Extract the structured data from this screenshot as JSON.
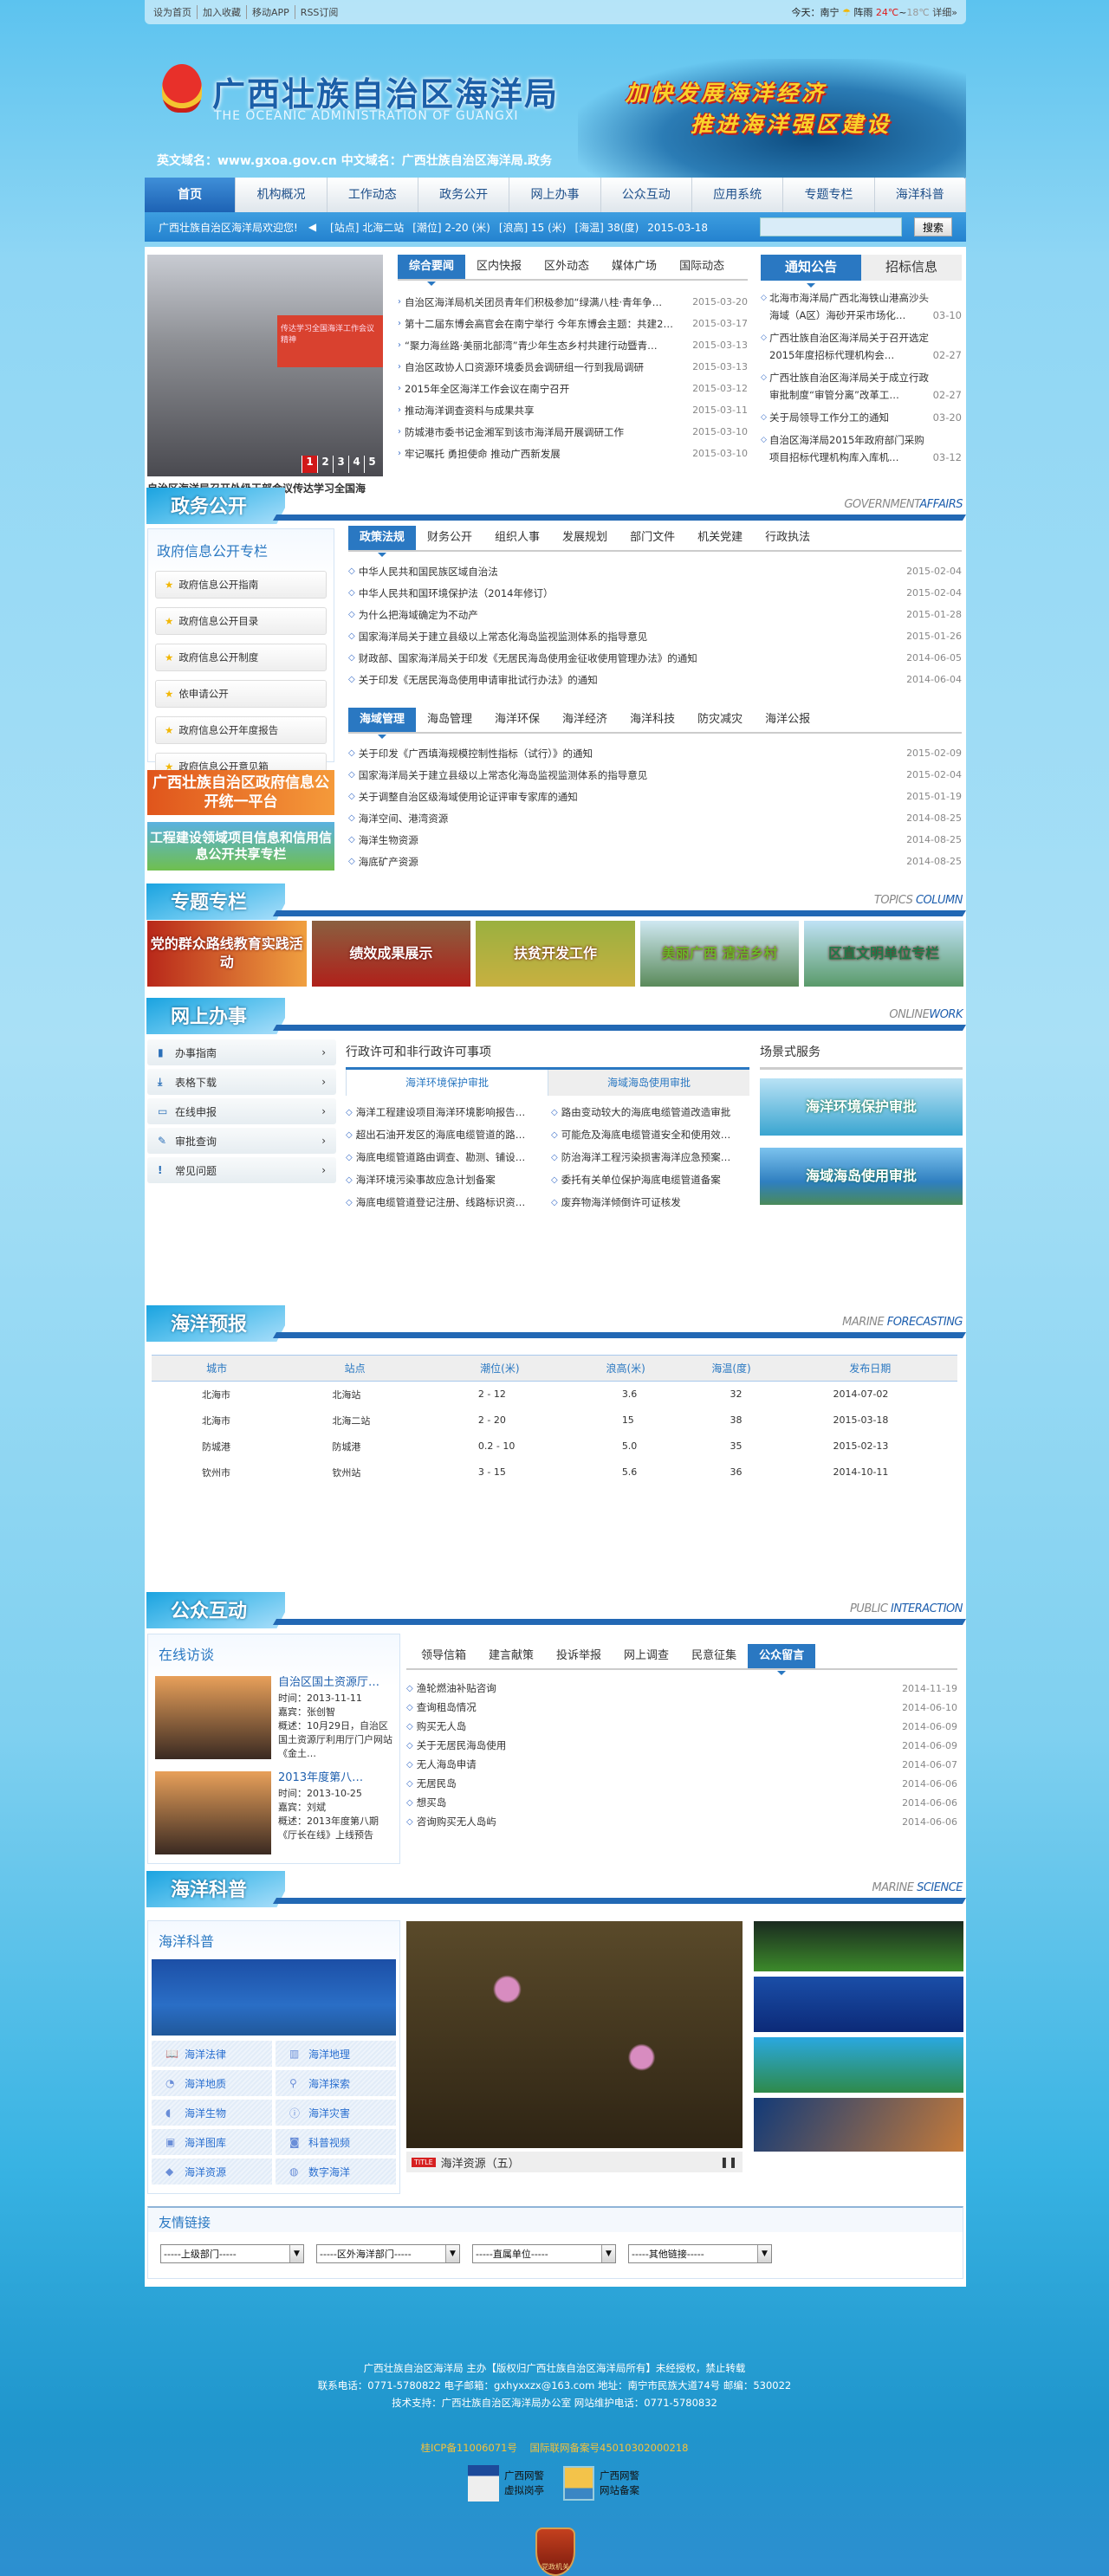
{
  "topbar": {
    "links": [
      "设为首页",
      "加入收藏",
      "移动APP",
      "RSS订阅"
    ],
    "weather": {
      "label": "今天：南宁",
      "cond": "阵雨",
      "high": "24℃",
      "sep": "~",
      "low": "18℃",
      "more": "详细»"
    }
  },
  "banner": {
    "title": "广西壮族自治区海洋局",
    "title_en": "THE OCEANIC ADMINISTRATION OF GUANGXI",
    "domain": "英文域名：www.gxoa.gov.cn  中文域名：广西壮族自治区海洋局.政务",
    "slogan1": "加快发展海洋经济",
    "slogan2": "推进海洋强区建设"
  },
  "nav": [
    "首页",
    "机构概况",
    "工作动态",
    "政务公开",
    "网上办事",
    "公众互动",
    "应用系统",
    "专题专栏",
    "海洋科普"
  ],
  "subbar": {
    "welcome": "广西壮族自治区海洋局欢迎您!",
    "station": "[站点] 北海二站",
    "tide": "[潮位] 2-20 (米)",
    "wave": "[浪高] 15 (米)",
    "temp": "[海温] 38(度)",
    "date": "2015-03-18",
    "search_btn": "搜索"
  },
  "slide": {
    "caption": "自治区海洋局召开处级干部会议传达学习全国海",
    "pages": [
      "1",
      "2",
      "3",
      "4",
      "5"
    ],
    "screen_text": "传达学习全国海洋工作会议精神"
  },
  "news": {
    "tabs": [
      "综合要闻",
      "区内快报",
      "区外动态",
      "媒体广场",
      "国际动态"
    ],
    "items": [
      {
        "t": "自治区海洋局机关团员青年们积极参加“绿满八桂·青年争…",
        "d": "2015-03-20"
      },
      {
        "t": "第十二届东博会高官会在南宁举行 今年东博会主题：共建2…",
        "d": "2015-03-17"
      },
      {
        "t": "“聚力海丝路·美丽北部湾”青少年生态乡村共建行动暨青…",
        "d": "2015-03-13"
      },
      {
        "t": "自治区政协人口资源环境委员会调研组一行到我局调研",
        "d": "2015-03-13"
      },
      {
        "t": "2015年全区海洋工作会议在南宁召开",
        "d": "2015-03-12"
      },
      {
        "t": "推动海洋调查资料与成果共享",
        "d": "2015-03-11"
      },
      {
        "t": "防城港市委书记金湘军到该市海洋局开展调研工作",
        "d": "2015-03-10"
      },
      {
        "t": "牢记嘱托 勇担使命 推动广西新发展",
        "d": "2015-03-10"
      }
    ]
  },
  "notice": {
    "tabs": [
      "通知公告",
      "招标信息"
    ],
    "items": [
      {
        "t": "北海市海洋局广西北海铁山港高沙头海域（A区）海砂开采市场化…",
        "d": "03-10"
      },
      {
        "t": "广西壮族自治区海洋局关于召开选定2015年度招标代理机构会…",
        "d": "02-27"
      },
      {
        "t": "广西壮族自治区海洋局关于成立行政审批制度“审管分离”改革工…",
        "d": "02-27"
      },
      {
        "t": "关于局领导工作分工的通知",
        "d": "03-20"
      },
      {
        "t": "自治区海洋局2015年政府部门采购项目招标代理机构库入库机…",
        "d": "03-12"
      }
    ]
  },
  "gov": {
    "title": "政务公开",
    "en1": "GOVERNMENT",
    "en2": "AFFAIRS",
    "side_title": "政府信息公开专栏",
    "side_items": [
      "政府信息公开指南",
      "政府信息公开目录",
      "政府信息公开制度",
      "依申请公开",
      "政府信息公开年度报告",
      "政府信息公开意见箱"
    ],
    "promo1": "广西壮族自治区政府信息公开统一平台",
    "promo2": "工程建设领域项目信息和信用信息公开共享专栏",
    "tabs1": [
      "政策法规",
      "财务公开",
      "组织人事",
      "发展规划",
      "部门文件",
      "机关党建",
      "行政执法"
    ],
    "list1": [
      {
        "t": "中华人民共和国民族区域自治法",
        "d": "2015-02-04"
      },
      {
        "t": "中华人民共和国环境保护法（2014年修订）",
        "d": "2015-02-04"
      },
      {
        "t": "为什么把海域确定为不动产",
        "d": "2015-01-28"
      },
      {
        "t": "国家海洋局关于建立县级以上常态化海岛监视监测体系的指导意见",
        "d": "2015-01-26"
      },
      {
        "t": "财政部、国家海洋局关于印发《无居民海岛使用金征收使用管理办法》的通知",
        "d": "2014-06-05"
      },
      {
        "t": "关于印发《无居民海岛使用申请审批试行办法》的通知",
        "d": "2014-06-04"
      }
    ],
    "tabs2": [
      "海域管理",
      "海岛管理",
      "海洋环保",
      "海洋经济",
      "海洋科技",
      "防灾减灾",
      "海洋公报"
    ],
    "list2": [
      {
        "t": "关于印发《广西填海规模控制性指标（试行）》的通知",
        "d": "2015-02-09"
      },
      {
        "t": "国家海洋局关于建立县级以上常态化海岛监视监测体系的指导意见",
        "d": "2015-02-04"
      },
      {
        "t": "关于调整自治区级海域使用论证评审专家库的通知",
        "d": "2015-01-19"
      },
      {
        "t": "海洋空间、港湾资源",
        "d": "2014-08-25"
      },
      {
        "t": "海洋生物资源",
        "d": "2014-08-25"
      },
      {
        "t": "海底矿产资源",
        "d": "2014-08-25"
      }
    ]
  },
  "topics": {
    "title": "专题专栏",
    "en1": "TOPICS",
    "en2": "COLUMN",
    "items": [
      "党的群众路线教育实践活动",
      "绩效成果展示",
      "扶贫开发工作",
      "美丽广西 清洁乡村",
      "区直文明单位专栏"
    ]
  },
  "online": {
    "title": "网上办事",
    "en1": "ONLINE",
    "en2": "WORK",
    "menu": [
      "办事指南",
      "表格下载",
      "在线申报",
      "审批查询",
      "常见问题"
    ],
    "mid_title": "行政许可和非行政许可事项",
    "mid_tabs": [
      "海洋环境保护审批",
      "海域海岛使用审批"
    ],
    "col1": [
      "海洋工程建设项目海洋环境影响报告…",
      "超出石油开发区的海底电缆管道的路…",
      "海底电缆管道路由调查、勘测、铺设…",
      "海洋环境污染事故应急计划备案",
      "海底电缆管道登记注册、线路标识资…"
    ],
    "col2": [
      "路由变动较大的海底电缆管道改造审批",
      "可能危及海底电缆管道安全和使用效…",
      "防治海洋工程污染损害海洋应急预案…",
      "委托有关单位保护海底电缆管道备案",
      "废弃物海洋倾倒许可证核发"
    ],
    "scene_title": "场景式服务",
    "scene": [
      "海洋环境保护审批",
      "海域海岛使用审批"
    ]
  },
  "forecast": {
    "title": "海洋预报",
    "en1": "MARINE",
    "en2": "FORECASTING",
    "headers": [
      "城市",
      "站点",
      "潮位(米)",
      "浪高(米)",
      "海温(度)",
      "发布日期"
    ],
    "rows": [
      [
        "北海市",
        "北海站",
        "2 - 12",
        "3.6",
        "32",
        "2014-07-02"
      ],
      [
        "北海市",
        "北海二站",
        "2 - 20",
        "15",
        "38",
        "2015-03-18"
      ],
      [
        "防城港",
        "防城港",
        "0.2 - 10",
        "5.0",
        "35",
        "2015-02-13"
      ],
      [
        "钦州市",
        "钦州站",
        "3 - 15",
        "5.6",
        "36",
        "2014-10-11"
      ]
    ]
  },
  "public": {
    "title": "公众互动",
    "en1": "PUBLIC",
    "en2": "INTERACTION",
    "side_title": "在线访谈",
    "interviews": [
      {
        "title": "自治区国土资源厅…",
        "time": "时间：2013-11-11",
        "guest": "嘉宾：张创智",
        "summary": "概述：10月29日，自治区国土资源厅利用厅门户网站《金土…"
      },
      {
        "title": "2013年度第八…",
        "time": "时间：2013-10-25",
        "guest": "嘉宾：刘斌",
        "summary": "概述：2013年度第八期《厅长在线》上线预告"
      }
    ],
    "tabs": [
      "领导信箱",
      "建言献策",
      "投诉举报",
      "网上调查",
      "民意征集",
      "公众留言"
    ],
    "list": [
      {
        "t": "渔轮燃油补贴咨询",
        "d": "2014-11-19"
      },
      {
        "t": "查询租岛情况",
        "d": "2014-06-10"
      },
      {
        "t": "购买无人岛",
        "d": "2014-06-09"
      },
      {
        "t": "关于无居民海岛使用",
        "d": "2014-06-09"
      },
      {
        "t": "无人海岛申请",
        "d": "2014-06-07"
      },
      {
        "t": "无居民岛",
        "d": "2014-06-06"
      },
      {
        "t": "想买岛",
        "d": "2014-06-06"
      },
      {
        "t": "咨询购买无人岛屿",
        "d": "2014-06-06"
      }
    ]
  },
  "science": {
    "title": "海洋科普",
    "en1": "MARINE",
    "en2": "SCIENCE",
    "side_title": "海洋科普",
    "grid": [
      {
        "l": "海洋法律",
        "i": "book-icon",
        "g": "📖"
      },
      {
        "l": "海洋地理",
        "i": "map-icon",
        "g": "▥"
      },
      {
        "l": "海洋地质",
        "i": "pie-chart-icon",
        "g": "◔"
      },
      {
        "l": "海洋探索",
        "i": "location-pin-icon",
        "g": "⚲"
      },
      {
        "l": "海洋生物",
        "i": "fish-icon",
        "g": "◖"
      },
      {
        "l": "海洋灾害",
        "i": "alert-icon",
        "g": "ⓘ"
      },
      {
        "l": "海洋图库",
        "i": "picture-icon",
        "g": "▣"
      },
      {
        "l": "科普视频",
        "i": "camera-icon",
        "g": "◙"
      },
      {
        "l": "海洋资源",
        "i": "diamond-icon",
        "g": "◆"
      },
      {
        "l": "数字海洋",
        "i": "globe-icon",
        "g": "◍"
      }
    ],
    "slide_badge": "TITLE",
    "slide_caption": "海洋资源（五）"
  },
  "links": {
    "title": "友情链接",
    "selects": [
      "-----上级部门-----",
      "-----区外海洋部门-----",
      "-----直属单位-----",
      "-----其他链接-----"
    ]
  },
  "footer": {
    "line1": "广西壮族自治区海洋局 主办【版权归广西壮族自治区海洋局所有】未经授权，禁止转载",
    "line2": "联系电话：0771-5780822 电子邮箱：gxhyxxzx@163.com 地址：南宁市民族大道74号 邮编：530022",
    "line3": "技术支持：广西壮族自治区海洋局办公室  网站维护电话：0771-5780832",
    "icp": "桂ICP备11006071号",
    "record": "国际联网备案号45010302000218",
    "badge1": "广西网警虚拟岗亭",
    "badge2": "广西网警网站备案",
    "seal": "党政机关"
  }
}
